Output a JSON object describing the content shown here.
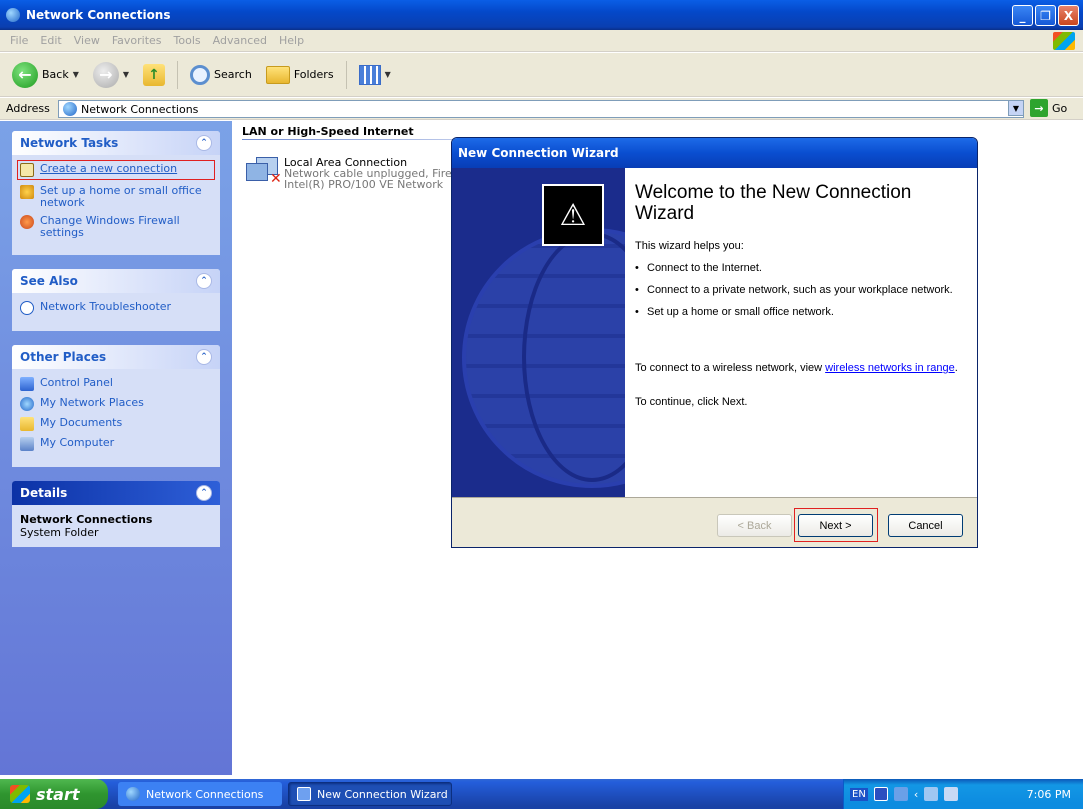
{
  "window": {
    "title": "Network Connections",
    "min": "_",
    "max": "❐",
    "close": "X"
  },
  "menu": {
    "items": [
      "File",
      "Edit",
      "View",
      "Favorites",
      "Tools",
      "Advanced",
      "Help"
    ]
  },
  "toolbar": {
    "back": "Back",
    "search": "Search",
    "folders": "Folders"
  },
  "address": {
    "label": "Address",
    "value": "Network Connections",
    "go": "Go"
  },
  "leftpane": {
    "network_tasks": {
      "title": "Network Tasks",
      "items": [
        "Create a new connection",
        "Set up a home or small office network",
        "Change Windows Firewall settings"
      ]
    },
    "see_also": {
      "title": "See Also",
      "items": [
        "Network Troubleshooter"
      ]
    },
    "other_places": {
      "title": "Other Places",
      "items": [
        "Control Panel",
        "My Network Places",
        "My Documents",
        "My Computer"
      ]
    },
    "details": {
      "title": "Details",
      "name": "Network Connections",
      "type": "System Folder"
    }
  },
  "content": {
    "group_title": "LAN or High-Speed Internet",
    "connection": {
      "name": "Local Area Connection",
      "status": "Network cable unplugged, Fire",
      "device": "Intel(R) PRO/100 VE Network"
    }
  },
  "wizard": {
    "title": "New Connection Wizard",
    "heading": "Welcome to the New Connection Wizard",
    "intro": "This wizard helps you:",
    "bullets": [
      "Connect to the Internet.",
      "Connect to a private network, such as your workplace network.",
      "Set up a home or small office network."
    ],
    "wireless_prefix": "To connect to a wireless network, view ",
    "wireless_link": "wireless networks in range",
    "wireless_suffix": ".",
    "continue": "To continue, click Next.",
    "buttons": {
      "back": "< Back",
      "next": "Next >",
      "cancel": "Cancel"
    }
  },
  "taskbar": {
    "start": "start",
    "tasks": [
      "Network Connections",
      "New Connection Wizard"
    ],
    "lang": "EN",
    "clock": "7:06 PM"
  }
}
